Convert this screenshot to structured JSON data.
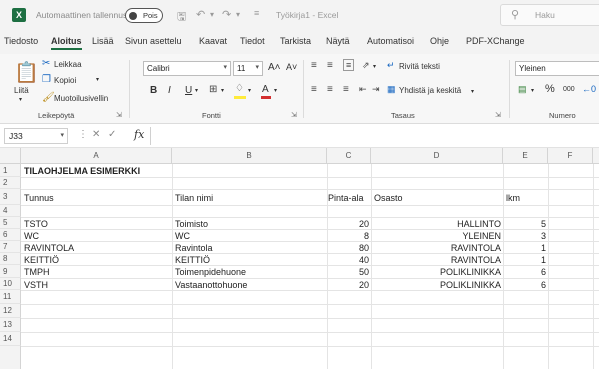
{
  "titlebar": {
    "logo": "X",
    "autosave_label": "Automaattinen tallennus",
    "toggle_state": "Pois",
    "doc_title": "Työkirja1 - Excel",
    "search_placeholder": "Haku",
    "icons": [
      "save-icon",
      "undo-icon",
      "redo-icon",
      "customize-icon"
    ]
  },
  "menu": {
    "tabs": [
      "Tiedosto",
      "Aloitus",
      "Lisää",
      "Sivun asettelu",
      "Kaavat",
      "Tiedot",
      "Tarkista",
      "Näytä",
      "Automatisoi",
      "Ohje",
      "PDF-XChange"
    ],
    "active_tab": "Aloitus"
  },
  "ribbon": {
    "clipboard": {
      "paste": "Liitä",
      "cut": "Leikkaa",
      "copy": "Kopioi",
      "format_painter": "Muotoilusivellin",
      "label": "Leikepöytä"
    },
    "font": {
      "font_name": "Calibri",
      "font_size": "11",
      "grow": "A˄",
      "shrink": "A˅",
      "bold": "B",
      "italic": "I",
      "underline": "U",
      "label": "Fontti"
    },
    "alignment": {
      "wrap_text": "Rivitä teksti",
      "merge_center": "Yhdistä ja keskitä",
      "label": "Tasaus"
    },
    "number": {
      "format": "Yleinen",
      "percent": "%",
      "thousands": "000",
      "label": "Numero"
    }
  },
  "formula_bar": {
    "name_box": "J33",
    "fx": "fx",
    "content": ""
  },
  "sheet": {
    "columns": [
      "A",
      "B",
      "C",
      "D",
      "E",
      "F"
    ],
    "rows": [
      "1",
      "2",
      "3",
      "4",
      "5",
      "6",
      "7",
      "8",
      "9",
      "10",
      "11",
      "12",
      "13",
      "14"
    ],
    "title": "TILAOHJELMA ESIMERKKI",
    "headers": {
      "tunnus": "Tunnus",
      "tilan_nimi": "Tilan nimi",
      "pinta_ala": "Pinta-ala",
      "osasto": "Osasto",
      "lkm": "lkm"
    },
    "data": [
      {
        "tunnus": "TSTO",
        "nimi": "Toimisto",
        "ala": "20",
        "osasto": "HALLINTO",
        "lkm": "5"
      },
      {
        "tunnus": "WC",
        "nimi": "WC",
        "ala": "8",
        "osasto": "YLEINEN",
        "lkm": "3"
      },
      {
        "tunnus": "RAVINTOLA",
        "nimi": "Ravintola",
        "ala": "80",
        "osasto": "RAVINTOLA",
        "lkm": "1"
      },
      {
        "tunnus": "KEITTIÖ",
        "nimi": "KEITTIÖ",
        "ala": "40",
        "osasto": "RAVINTOLA",
        "lkm": "1"
      },
      {
        "tunnus": "TMPH",
        "nimi": "Toimenpidehuone",
        "ala": "50",
        "osasto": "POLIKLINIKKA",
        "lkm": "6"
      },
      {
        "tunnus": "VSTH",
        "nimi": "Vastaanottohuone",
        "ala": "20",
        "osasto": "POLIKLINIKKA",
        "lkm": "6"
      }
    ]
  },
  "colors": {
    "excel_green": "#1d6f42",
    "chrome_bg": "#f3f3f3"
  }
}
